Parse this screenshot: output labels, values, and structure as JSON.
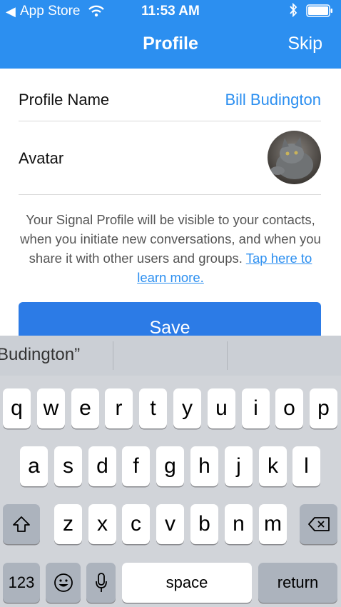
{
  "status_bar": {
    "back_glyph": "◀",
    "carrier": "App Store",
    "time": "11:53 AM"
  },
  "nav": {
    "title": "Profile",
    "skip_label": "Skip",
    "bar_color": "#2c8ff0"
  },
  "profile": {
    "name_label": "Profile Name",
    "name_value": "Bill Budington",
    "avatar_label": "Avatar",
    "info_text": "Your Signal Profile will be visible to your contacts, when you initiate new conversations, and when you share it with other users and groups.",
    "info_link": "Tap here to learn more.",
    "save_label": "Save"
  },
  "keyboard": {
    "suggestion": "“Budington”",
    "row1": [
      "q",
      "w",
      "e",
      "r",
      "t",
      "y",
      "u",
      "i",
      "o",
      "p"
    ],
    "row2": [
      "a",
      "s",
      "d",
      "f",
      "g",
      "h",
      "j",
      "k",
      "l"
    ],
    "row3": [
      "z",
      "x",
      "c",
      "v",
      "b",
      "n",
      "m"
    ],
    "numbers_label": "123",
    "space_label": "space",
    "return_label": "return",
    "icons": [
      "shift-icon",
      "delete-icon",
      "emoji-icon",
      "microphone-icon"
    ]
  }
}
